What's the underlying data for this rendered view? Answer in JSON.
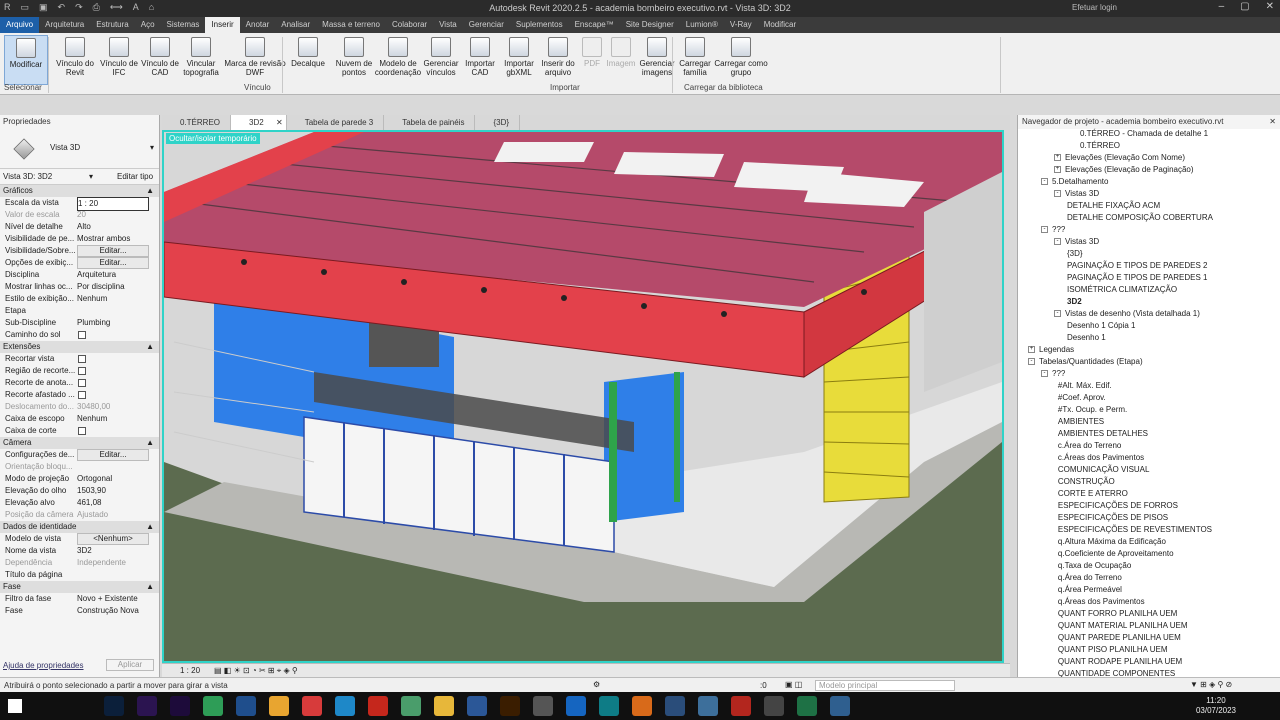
{
  "window": {
    "title": "Autodesk Revit 2020.2.5 - academia bombeiro executivo.rvt - Vista 3D: 3D2",
    "user": "Efetuar login"
  },
  "ribbon_tabs": [
    "Arquivo",
    "Arquitetura",
    "Estrutura",
    "Aço",
    "Sistemas",
    "Inserir",
    "Anotar",
    "Analisar",
    "Massa e terreno",
    "Colaborar",
    "Vista",
    "Gerenciar",
    "Suplementos",
    "Enscape™",
    "Site Designer",
    "Lumion®",
    "V-Ray",
    "Modificar"
  ],
  "ribbon": {
    "buttons": [
      {
        "label": "Modificar",
        "icon": "cursor-icon"
      },
      {
        "label": "Vínculo do Revit",
        "icon": "rvt-link-icon"
      },
      {
        "label": "Vínculo de IFC",
        "icon": "ifc-link-icon"
      },
      {
        "label": "Vínculo de CAD",
        "icon": "cad-link-icon"
      },
      {
        "label": "Vincular topografia",
        "icon": "topography-icon"
      },
      {
        "label": "Marca de revisão DWF",
        "icon": "dwf-markup-icon"
      },
      {
        "label": "Decalque",
        "icon": "decal-icon"
      },
      {
        "label": "Nuvem de pontos",
        "icon": "point-cloud-icon"
      },
      {
        "label": "Modelo de coordenação",
        "icon": "coordination-model-icon"
      },
      {
        "label": "Gerenciar vínculos",
        "icon": "manage-links-icon"
      },
      {
        "label": "Importar CAD",
        "icon": "import-cad-icon"
      },
      {
        "label": "Importar gbXML",
        "icon": "import-gbxml-icon"
      },
      {
        "label": "Inserir do arquivo",
        "icon": "insert-file-icon"
      },
      {
        "label": "PDF",
        "icon": "pdf-icon"
      },
      {
        "label": "Imagem",
        "icon": "image-icon"
      },
      {
        "label": "Gerenciar imagens",
        "icon": "manage-images-icon"
      },
      {
        "label": "Carregar família",
        "icon": "load-family-icon"
      },
      {
        "label": "Carregar como grupo",
        "icon": "load-group-icon"
      }
    ],
    "panels": [
      "Selecionar",
      "Vínculo",
      "Importar",
      "Carregar da biblioteca"
    ]
  },
  "properties": {
    "header": "Propriedades",
    "type": "Vista 3D",
    "filter": "Vista 3D: 3D2",
    "edit_type": "Editar tipo",
    "help": "Ajuda de propriedades",
    "apply": "Aplicar",
    "sections": [
      {
        "title": "Gráficos",
        "rows": [
          {
            "k": "Escala da vista",
            "v": "1 : 20",
            "type": "input"
          },
          {
            "k": "Valor de escala",
            "v": "20",
            "type": "gray",
            "k_prefix": "1:"
          },
          {
            "k": "Nível de detalhe",
            "v": "Alto"
          },
          {
            "k": "Visibilidade de pe...",
            "v": "Mostrar ambos"
          },
          {
            "k": "Visibilidade/Sobre...",
            "v": "Editar...",
            "type": "btn"
          },
          {
            "k": "Opções de exibiç...",
            "v": "Editar...",
            "type": "btn"
          },
          {
            "k": "Disciplina",
            "v": "Arquitetura"
          },
          {
            "k": "Mostrar linhas oc...",
            "v": "Por disciplina"
          },
          {
            "k": "Estilo de exibição...",
            "v": "Nenhum"
          },
          {
            "k": "Etapa",
            "v": ""
          },
          {
            "k": "Sub-Discipline",
            "v": "Plumbing"
          },
          {
            "k": "Caminho do sol",
            "v": "",
            "type": "check"
          }
        ]
      },
      {
        "title": "Extensões",
        "rows": [
          {
            "k": "Recortar vista",
            "v": "",
            "type": "check"
          },
          {
            "k": "Região de recorte...",
            "v": "",
            "type": "check"
          },
          {
            "k": "Recorte de anota...",
            "v": "",
            "type": "check"
          },
          {
            "k": "Recorte afastado ...",
            "v": "",
            "type": "check"
          },
          {
            "k": "Deslocamento do...",
            "v": "30480,00",
            "type": "gray"
          },
          {
            "k": "Caixa de escopo",
            "v": "Nenhum"
          },
          {
            "k": "Caixa de corte",
            "v": "",
            "type": "check"
          }
        ]
      },
      {
        "title": "Câmera",
        "rows": [
          {
            "k": "Configurações de...",
            "v": "Editar...",
            "type": "btn"
          },
          {
            "k": "Orientação bloqu...",
            "v": "",
            "type": "gray"
          },
          {
            "k": "Modo de projeção",
            "v": "Ortogonal"
          },
          {
            "k": "Elevação do olho",
            "v": "1503,90"
          },
          {
            "k": "Elevação alvo",
            "v": "461,08"
          },
          {
            "k": "Posição da câmera",
            "v": "Ajustado",
            "type": "gray"
          }
        ]
      },
      {
        "title": "Dados de identidade",
        "rows": [
          {
            "k": "Modelo de vista",
            "v": "<Nenhum>",
            "type": "btn"
          },
          {
            "k": "Nome da vista",
            "v": "3D2"
          },
          {
            "k": "Dependência",
            "v": "Independente",
            "type": "gray"
          },
          {
            "k": "Título da página",
            "v": ""
          }
        ]
      },
      {
        "title": "Fase",
        "rows": [
          {
            "k": "Filtro da fase",
            "v": "Novo + Existente"
          },
          {
            "k": "Fase",
            "v": "Construção Nova"
          }
        ]
      }
    ]
  },
  "view_tabs": [
    {
      "label": "0.TÉRREO",
      "active": false
    },
    {
      "label": "3D2",
      "active": true
    },
    {
      "label": "Tabela de parede 3",
      "active": false
    },
    {
      "label": "Tabela de painéis",
      "active": false
    },
    {
      "label": "{3D}",
      "active": false
    }
  ],
  "viewport": {
    "banner": "Ocultar/isolar temporário",
    "scale": "1 : 20"
  },
  "browser": {
    "header": "Navegador de projeto - academia bombeiro executivo.rvt",
    "items": [
      {
        "t": "0.TÉRREO - Chamada de detalhe 1",
        "lvl": 4
      },
      {
        "t": "0.TÉRREO",
        "lvl": 4
      },
      {
        "t": "Elevações (Elevação Com Nome)",
        "lvl": 2,
        "ex": "+"
      },
      {
        "t": "Elevações (Elevação de Paginação)",
        "lvl": 2,
        "ex": "+"
      },
      {
        "t": "5.Detalhamento",
        "lvl": 1,
        "ex": "-"
      },
      {
        "t": "Vistas 3D",
        "lvl": 2,
        "ex": "-"
      },
      {
        "t": "DETALHE FIXAÇÃO ACM",
        "lvl": 3
      },
      {
        "t": "DETALHE COMPOSIÇÃO COBERTURA",
        "lvl": 3
      },
      {
        "t": "???",
        "lvl": 1,
        "ex": "-"
      },
      {
        "t": "Vistas 3D",
        "lvl": 2,
        "ex": "-"
      },
      {
        "t": "{3D}",
        "lvl": 3
      },
      {
        "t": "PAGINAÇÃO E TIPOS DE PAREDES 2",
        "lvl": 3
      },
      {
        "t": "PAGINAÇÃO E TIPOS DE PAREDES 1",
        "lvl": 3
      },
      {
        "t": "ISOMÉTRICA CLIMATIZAÇÃO",
        "lvl": 3
      },
      {
        "t": "3D2",
        "lvl": 3,
        "bold": true
      },
      {
        "t": "Vistas de desenho (Vista detalhada 1)",
        "lvl": 2,
        "ex": "-"
      },
      {
        "t": "Desenho 1 Cópia 1",
        "lvl": 3
      },
      {
        "t": "Desenho 1",
        "lvl": 3
      },
      {
        "t": "Legendas",
        "lvl": 0,
        "ex": "+"
      },
      {
        "t": "Tabelas/Quantidades (Etapa)",
        "lvl": 0,
        "ex": "-"
      },
      {
        "t": "???",
        "lvl": 1,
        "ex": "-"
      },
      {
        "t": "#Alt. Máx. Edif.",
        "lvl": 2.3
      },
      {
        "t": "#Coef. Aprov.",
        "lvl": 2.3
      },
      {
        "t": "#Tx. Ocup. e Perm.",
        "lvl": 2.3
      },
      {
        "t": "AMBIENTES",
        "lvl": 2.3
      },
      {
        "t": "AMBIENTES DETALHES",
        "lvl": 2.3
      },
      {
        "t": "c.Área do Terreno",
        "lvl": 2.3
      },
      {
        "t": "c.Áreas dos Pavimentos",
        "lvl": 2.3
      },
      {
        "t": "COMUNICAÇÃO VISUAL",
        "lvl": 2.3
      },
      {
        "t": "CONSTRUÇÃO",
        "lvl": 2.3
      },
      {
        "t": "CORTE E ATERRO",
        "lvl": 2.3
      },
      {
        "t": "ESPECIFICAÇÕES DE FORROS",
        "lvl": 2.3
      },
      {
        "t": "ESPECIFICAÇÕES DE PISOS",
        "lvl": 2.3
      },
      {
        "t": "ESPECIFICAÇÕES DE REVESTIMENTOS",
        "lvl": 2.3
      },
      {
        "t": "q.Altura Máxima da Edificação",
        "lvl": 2.3
      },
      {
        "t": "q.Coeficiente de Aproveitamento",
        "lvl": 2.3
      },
      {
        "t": "q.Taxa de Ocupação",
        "lvl": 2.3
      },
      {
        "t": "q.Área do Terreno",
        "lvl": 2.3
      },
      {
        "t": "q.Área Permeável",
        "lvl": 2.3
      },
      {
        "t": "q.Áreas dos Pavimentos",
        "lvl": 2.3
      },
      {
        "t": "QUANT FORRO PLANILHA UEM",
        "lvl": 2.3
      },
      {
        "t": "QUANT MATERIAL PLANILHA UEM",
        "lvl": 2.3
      },
      {
        "t": "QUANT PAREDE PLANILHA UEM",
        "lvl": 2.3
      },
      {
        "t": "QUANT PISO PLANILHA UEM",
        "lvl": 2.3
      },
      {
        "t": "QUANT RODAPE PLANILHA UEM",
        "lvl": 2.3
      },
      {
        "t": "QUANTIDADE COMPONENTES",
        "lvl": 2.3
      }
    ]
  },
  "status": {
    "message": "Atribuirá o ponto selecionado a partir a mover para girar a vista",
    "model": "Modelo principal",
    "zero": ":0"
  },
  "taskbar": {
    "time": "11:20",
    "date": "03/07/2023",
    "apps": [
      {
        "name": "search-icon",
        "color": "#101010"
      },
      {
        "name": "task-view-icon",
        "color": "#101010"
      },
      {
        "name": "photoshop-icon",
        "color": "#0b1f3a"
      },
      {
        "name": "after-effects-icon",
        "color": "#2b1450"
      },
      {
        "name": "premiere-icon",
        "color": "#1d0b3a"
      },
      {
        "name": "app-green-icon",
        "color": "#2e9d57"
      },
      {
        "name": "revit-icon",
        "color": "#1f4e8c"
      },
      {
        "name": "chrome-icon",
        "color": "#e8a530"
      },
      {
        "name": "app-red-icon",
        "color": "#d73b3b"
      },
      {
        "name": "edge-icon",
        "color": "#1e88c8"
      },
      {
        "name": "acrobat-icon",
        "color": "#c5271c"
      },
      {
        "name": "notes-icon",
        "color": "#4a9d6b"
      },
      {
        "name": "explorer-icon",
        "color": "#e7b73a"
      },
      {
        "name": "word-icon",
        "color": "#2b5797"
      },
      {
        "name": "illustrator-icon",
        "color": "#3a1d00"
      },
      {
        "name": "app-gray-icon",
        "color": "#555"
      },
      {
        "name": "app-blue-icon",
        "color": "#1565c0"
      },
      {
        "name": "app-teal-icon",
        "color": "#0e7c86"
      },
      {
        "name": "app-orange-icon",
        "color": "#d86a1a"
      },
      {
        "name": "app-navy-icon",
        "color": "#2a4d7a"
      },
      {
        "name": "app-steel-icon",
        "color": "#3d6f9b"
      },
      {
        "name": "app-red2-icon",
        "color": "#b3261e"
      },
      {
        "name": "app-dark-icon",
        "color": "#444"
      },
      {
        "name": "excel-icon",
        "color": "#1e7145"
      },
      {
        "name": "app-photo-icon",
        "color": "#2f5f8f"
      }
    ]
  },
  "colors": {
    "accent": "#1d5fa8",
    "viewport_border": "#2fd3c8",
    "roof_beam": "#e3414b",
    "wall_blue": "#2f7fe8",
    "panel_yellow": "#e8dc3a",
    "ground_green": "#5c6b4f"
  }
}
